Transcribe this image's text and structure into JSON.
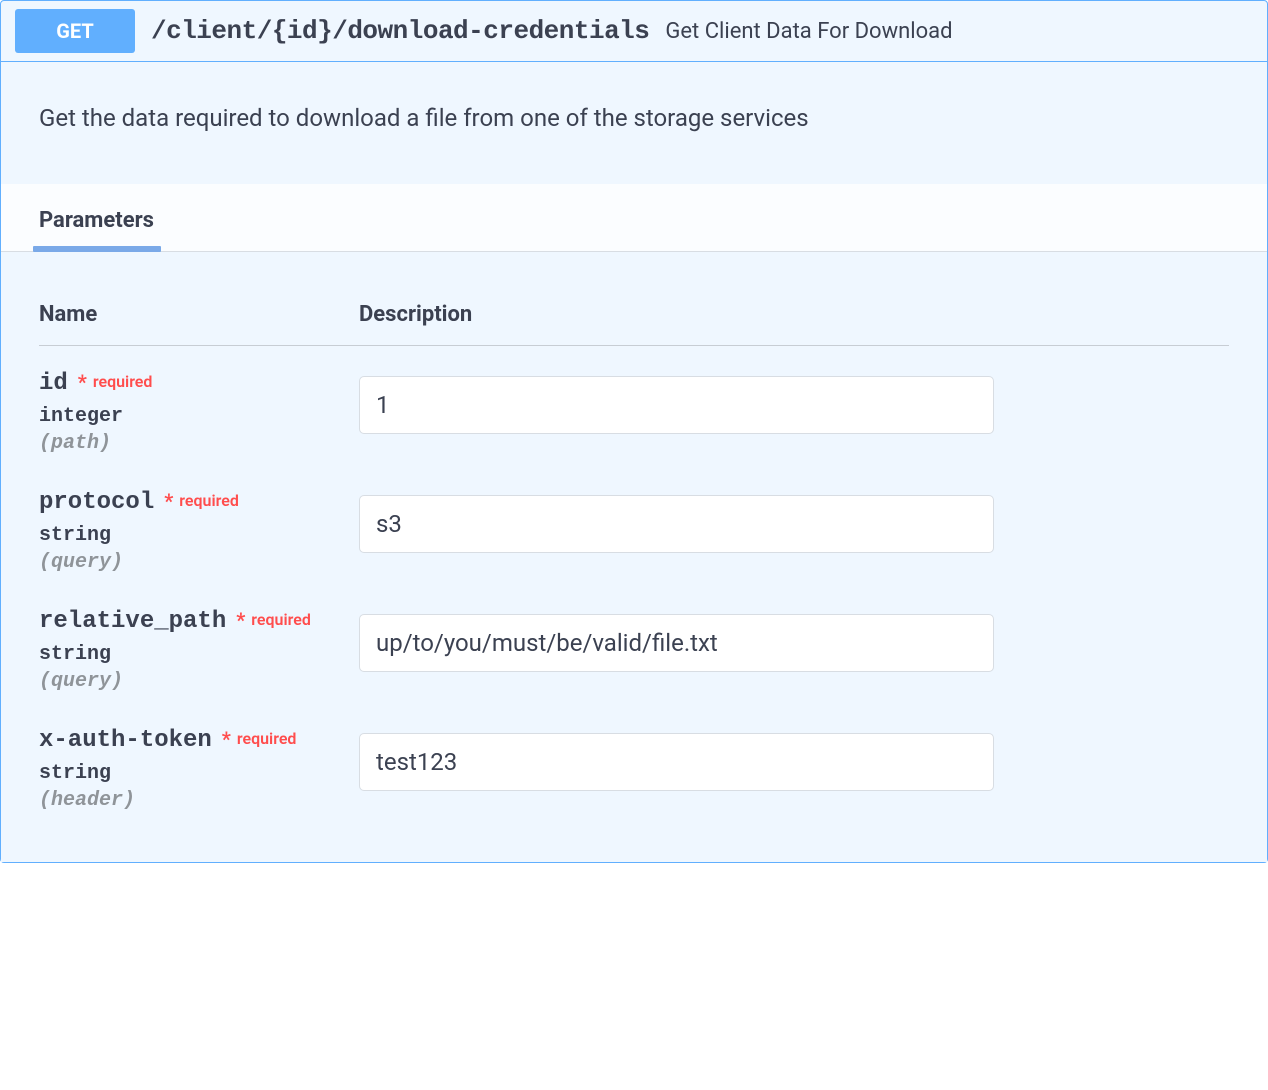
{
  "summary": {
    "method": "GET",
    "path": "/client/{id}/download-credentials",
    "title": "Get Client Data For Download"
  },
  "description": "Get the data required to download a file from one of the storage services",
  "tabs": {
    "parameters_label": "Parameters"
  },
  "table": {
    "col_name": "Name",
    "col_description": "Description",
    "required_label": "required",
    "star": "*"
  },
  "parameters": [
    {
      "name": "id",
      "required": true,
      "type": "integer",
      "in": "(path)",
      "value": "1"
    },
    {
      "name": "protocol",
      "required": true,
      "type": "string",
      "in": "(query)",
      "value": "s3"
    },
    {
      "name": "relative_path",
      "required": true,
      "type": "string",
      "in": "(query)",
      "value": "up/to/you/must/be/valid/file.txt"
    },
    {
      "name": "x-auth-token",
      "required": true,
      "type": "string",
      "in": "(header)",
      "value": "test123"
    }
  ]
}
